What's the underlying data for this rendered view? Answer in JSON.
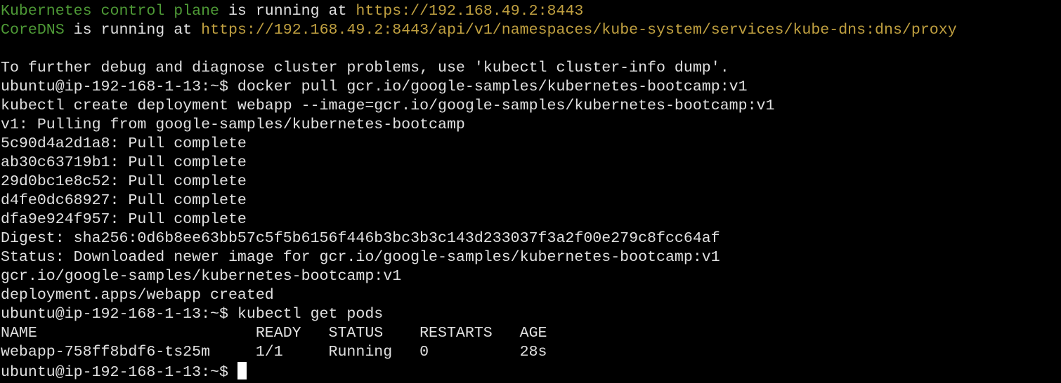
{
  "cluster_info": {
    "control_plane_label": "Kubernetes control plane",
    "control_plane_mid": " is running at ",
    "control_plane_url": "https://192.168.49.2:8443",
    "coredns_label": "CoreDNS",
    "coredns_mid": " is running at ",
    "coredns_url": "https://192.168.49.2:8443/api/v1/namespaces/kube-system/services/kube-dns:dns/proxy",
    "debug_hint": "To further debug and diagnose cluster problems, use 'kubectl cluster-info dump'."
  },
  "prompt": "ubuntu@ip-192-168-1-13:~$ ",
  "commands": {
    "docker_pull": "docker pull gcr.io/google-samples/kubernetes-bootcamp:v1",
    "create_deployment": "kubectl create deployment webapp --image=gcr.io/google-samples/kubernetes-bootcamp:v1",
    "get_pods": "kubectl get pods"
  },
  "pull_output": {
    "pulling": "v1: Pulling from google-samples/kubernetes-bootcamp",
    "layers": [
      "5c90d4a2d1a8: Pull complete",
      "ab30c63719b1: Pull complete",
      "29d0bc1e8c52: Pull complete",
      "d4fe0dc68927: Pull complete",
      "dfa9e924f957: Pull complete"
    ],
    "digest": "Digest: sha256:0d6b8ee63bb57c5f5b6156f446b3bc3b3c143d233037f3a2f00e279c8fcc64af",
    "status": "Status: Downloaded newer image for gcr.io/google-samples/kubernetes-bootcamp:v1",
    "image": "gcr.io/google-samples/kubernetes-bootcamp:v1"
  },
  "deployment_result": "deployment.apps/webapp created",
  "pods_table": {
    "header": "NAME                        READY   STATUS    RESTARTS   AGE",
    "row": "webapp-758ff8bdf6-ts25m     1/1     Running   0          28s"
  },
  "colors": {
    "background": "#000000",
    "text": "#e0e0e0",
    "label_green": "#4e9a36",
    "url_yellow": "#c0a040",
    "cursor": "#ffffff"
  }
}
